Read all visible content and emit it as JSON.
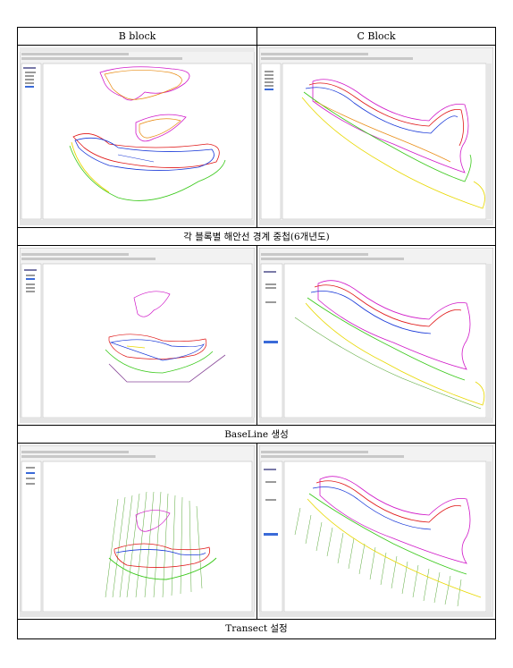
{
  "headers": {
    "left": "B block",
    "right": "C Block"
  },
  "captions": {
    "row1": "각 블록별 해안선 경계 중첩(6개년도)",
    "row2": "BaseLine 생성",
    "row3": "Transect 설정"
  },
  "colors": {
    "yellow": "#e8d800",
    "orange": "#e88a10",
    "red": "#e01818",
    "magenta": "#d018c8",
    "blue": "#1838d8",
    "green": "#38c818",
    "transect": "#58a838",
    "baseline": "#8a4a9a"
  },
  "icons": {
    "window": "gis-app-window-icon"
  }
}
